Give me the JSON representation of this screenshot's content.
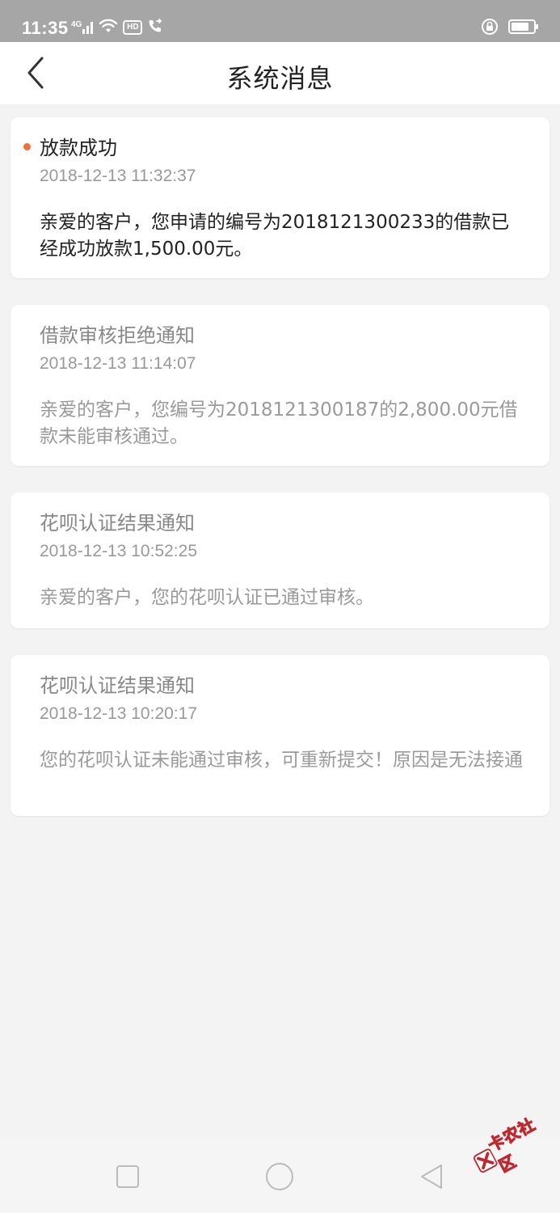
{
  "status_bar": {
    "time": "11:35",
    "network": "4G",
    "hd": "HD"
  },
  "header": {
    "title": "系统消息"
  },
  "messages": [
    {
      "title": "放款成功",
      "time": "2018-12-13 11:32:37",
      "body": "亲爱的客户，您申请的编号为2018121300233的借款已经成功放款1,500.00元。",
      "unread": true
    },
    {
      "title": "借款审核拒绝通知",
      "time": "2018-12-13 11:14:07",
      "body": "亲爱的客户，您编号为2018121300187的2,800.00元借款未能审核通过。",
      "unread": false
    },
    {
      "title": "花呗认证结果通知",
      "time": "2018-12-13 10:52:25",
      "body": "亲爱的客户，您的花呗认证已通过审核。",
      "unread": false
    },
    {
      "title": "花呗认证结果通知",
      "time": "2018-12-13 10:20:17",
      "body": "您的花呗认证未能通过审核，可重新提交！原因是无法接通",
      "unread": false
    }
  ],
  "watermark": {
    "text": "卡农社区"
  },
  "colors": {
    "status_bar_bg": "#a6a6a6",
    "unread_dot": "#f07035",
    "watermark": "#c0262d"
  }
}
